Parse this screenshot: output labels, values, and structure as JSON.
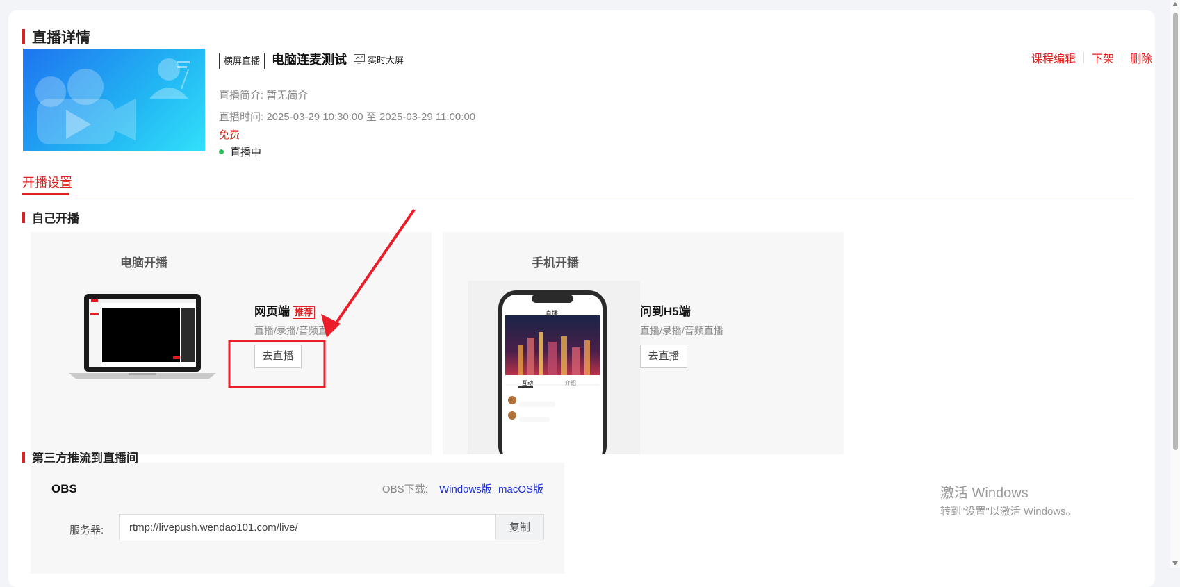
{
  "page_title": "直播详情",
  "course": {
    "tag": "横屏直播",
    "name": "电脑连麦测试",
    "screen_btn": "实时大屏",
    "intro": "直播简介: 暂无简介",
    "time": "直播时间:  2025-03-29 10:30:00 至 2025-03-29 11:00:00",
    "price": "免费",
    "status": "直播中"
  },
  "actions": {
    "edit": "课程编辑",
    "off": "下架",
    "delete": "删除"
  },
  "tab": "开播设置",
  "self_live": {
    "title": "自己开播",
    "pc": {
      "panel_title": "电脑开播",
      "option_title": "网页端",
      "badge": "推荐",
      "desc": "直播/录播/音频直",
      "button": "去直播"
    },
    "mobile": {
      "panel_title": "手机开播",
      "option_title": "问到H5端",
      "desc": "直播/录播/音频直播",
      "button": "去直播",
      "phone_header": "直播",
      "phone_tab_left": "互动",
      "phone_tab_right": "介绍"
    }
  },
  "third_party": {
    "title": "第三方推流到直播间",
    "obs_title": "OBS",
    "download_label": "OBS下载:",
    "windows_link": "Windows版",
    "mac_link": "macOS版",
    "server_label": "服务器:",
    "server_value": "rtmp://livepush.wendao101.com/live/",
    "copy": "复制"
  },
  "watermark": {
    "line1": "激活 Windows",
    "line2": "转到\"设置\"以激活 Windows。"
  },
  "colors": {
    "accent": "#e02020",
    "link": "#1a2fd8",
    "live_dot": "#2bbf5a"
  }
}
